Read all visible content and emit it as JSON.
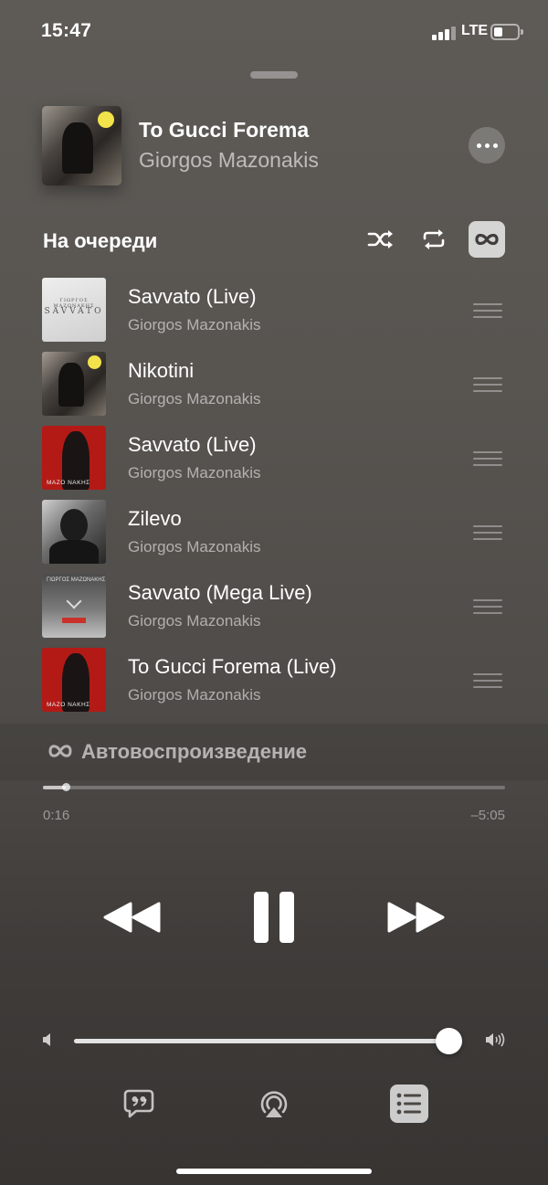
{
  "status_bar": {
    "time": "15:47",
    "network": "LTE",
    "battery_level": 0.3
  },
  "now_playing": {
    "title": "To Gucci Forema",
    "artist": "Giorgos Mazonakis",
    "art_icon": "album-art-photo"
  },
  "queue": {
    "header": "На очереди",
    "controls": {
      "shuffle_icon": "shuffle-icon",
      "repeat_icon": "repeat-icon",
      "autoplay_icon": "infinity-icon",
      "autoplay_active": true
    },
    "items": [
      {
        "title": "Savvato (Live)",
        "artist": "Giorgos Mazonakis",
        "art_style": "white",
        "art_text": "SAVVATO",
        "art_text_small": "ΓΙΩΡΓΟΣ ΜΑΖΩΝΑΚΗΣ"
      },
      {
        "title": "Nikotini",
        "artist": "Giorgos Mazonakis",
        "art_style": "photo"
      },
      {
        "title": "Savvato (Live)",
        "artist": "Giorgos Mazonakis",
        "art_style": "red",
        "art_text": "MAZO    NAKHΣ"
      },
      {
        "title": "Zilevo",
        "artist": "Giorgos Mazonakis",
        "art_style": "bw"
      },
      {
        "title": "Savvato (Mega Live)",
        "artist": "Giorgos Mazonakis",
        "art_style": "grey",
        "art_text": "ΓΙΩΡΓΟΣ ΜΑΖΩΝΑΚΗΣ"
      },
      {
        "title": "To Gucci Forema (Live)",
        "artist": "Giorgos Mazonakis",
        "art_style": "red",
        "art_text": "MAZO    NAKHΣ"
      }
    ]
  },
  "autoplay": {
    "label": "Автовоспроизведение",
    "icon": "infinity-icon"
  },
  "playback": {
    "elapsed": "0:16",
    "remaining": "–5:05",
    "progress": 0.05
  },
  "transport": {
    "previous_icon": "rewind-icon",
    "play_pause_icon": "pause-icon",
    "next_icon": "fast-forward-icon"
  },
  "volume": {
    "level": 0.98,
    "min_icon": "speaker-low-icon",
    "max_icon": "speaker-high-icon"
  },
  "bottom_bar": {
    "lyrics_icon": "lyrics-quote-icon",
    "airplay_icon": "airplay-icon",
    "queue_icon": "queue-list-icon",
    "queue_active": true
  },
  "colors": {
    "background": "#575450",
    "accent": "#ffffff",
    "active_button_bg": "#bfbebd"
  }
}
